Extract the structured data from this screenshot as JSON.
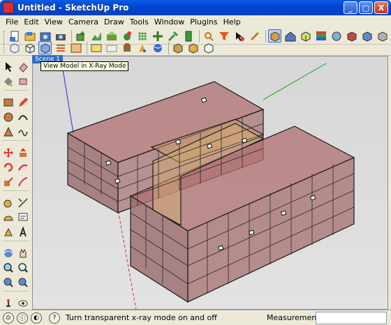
{
  "window": {
    "title": "Untitled - SketchUp Pro",
    "minimize": "_",
    "maximize": "□",
    "close": "X"
  },
  "menu": [
    "File",
    "Edit",
    "View",
    "Camera",
    "Draw",
    "Tools",
    "Window",
    "Plugins",
    "Help"
  ],
  "toolbar1": {
    "group1": [
      "new-icon",
      "open-icon",
      "save-icon",
      "camera-icon"
    ],
    "group2": [
      "component-icon",
      "sandbox-icon",
      "terrain-icon",
      "plant-icon",
      "grid-icon",
      "move-tool-icon",
      "wrench-icon",
      "battery-icon"
    ],
    "group3": [
      "zoom-icon",
      "filter-icon",
      "cursor-icon",
      "ruler-icon"
    ],
    "group4": [
      "box-icon",
      "house-icon",
      "shaded-icon",
      "stripes-icon",
      "color-ball-icon",
      "cube-red-icon",
      "cube-blue-icon",
      "cube-gray-icon"
    ]
  },
  "toolbar2": [
    "xray-icon",
    "cube-wire-icon",
    "xray-mode-icon",
    "lines-icon",
    "calendar-icon",
    "photo-icon",
    "folder-icon",
    "layers-icon",
    "rotate-icon",
    "sphere-icon",
    "cube-ball-icon",
    "cube-rotate-icon",
    "cube-light-icon"
  ],
  "scene": {
    "tab_label": "Scene 1"
  },
  "tooltip": {
    "text": "View Model in X-Ray Mode"
  },
  "status": {
    "icons": [
      "geo-icon",
      "credits-icon",
      "user-icon",
      "help-icon"
    ],
    "hint": "Turn transparent x-ray mode on and off",
    "measurements_label": "Measurements",
    "measurements_value": ""
  },
  "colors": {
    "titlebar": "#0046d6",
    "building_fill": "#a86060",
    "building_edge": "#1a1a1a",
    "axis_green": "#1aa01a",
    "axis_blue": "#2a2acf",
    "axis_red": "#cc2a2a"
  }
}
